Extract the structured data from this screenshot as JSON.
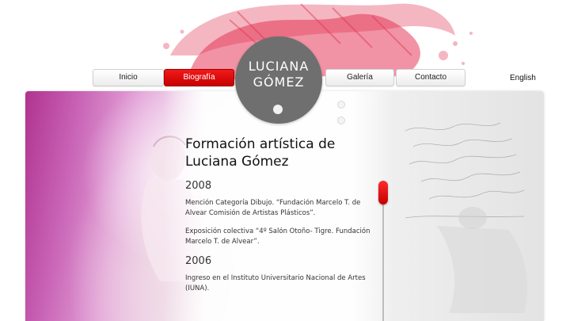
{
  "nav": {
    "items": [
      {
        "label": "Inicio"
      },
      {
        "label": "Biografía"
      },
      {
        "label": "Galería"
      },
      {
        "label": "Contacto"
      }
    ],
    "active_index": 1,
    "language": "English"
  },
  "logo": {
    "line1": "LUCIANA",
    "line2": "GÓMEZ"
  },
  "content": {
    "title": "Formación artística de Luciana Gómez",
    "sections": [
      {
        "year": "2008",
        "entries": [
          "Mención Categoría Dibujo. “Fundación Marcelo T. de Alvear Comisión de Artistas Plásticos”.",
          "Exposición colectiva “4º Salón Otoño- Tigre. Fundación Marcelo T. de Alvear”."
        ]
      },
      {
        "year": "2006",
        "entries": [
          "Ingreso en el Instituto Universitario Nacional de Artes (IUNA)."
        ]
      }
    ]
  },
  "colors": {
    "accent": "#e00000",
    "logo_bg": "#6f6f6f",
    "paint_magenta": "#b0338f"
  },
  "scroll": {
    "position": 0.0
  }
}
